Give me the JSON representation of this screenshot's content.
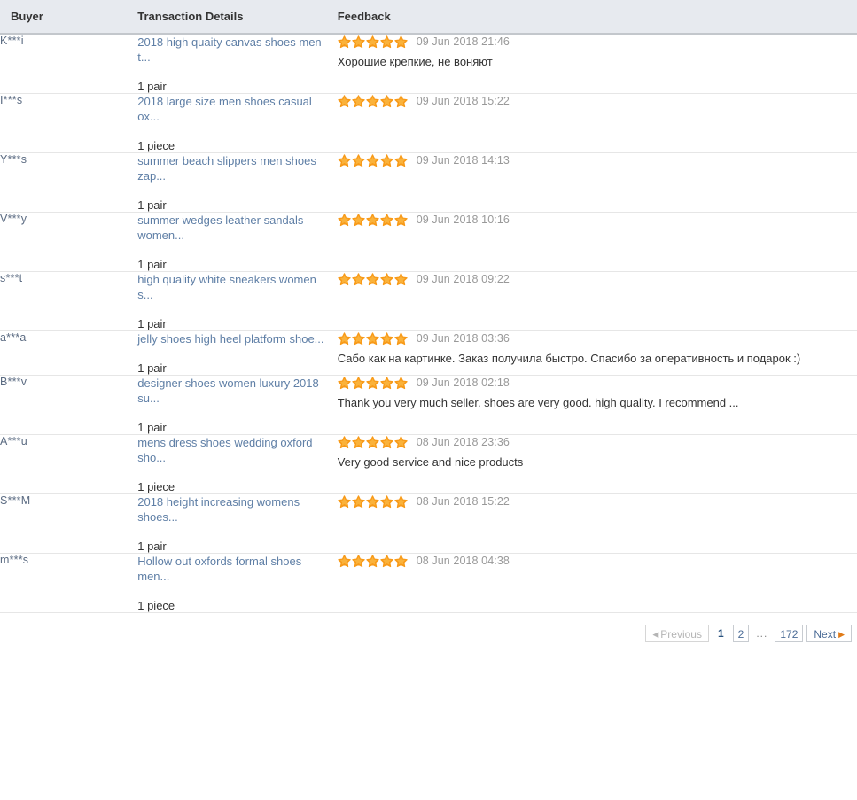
{
  "table": {
    "columns": [
      {
        "key": "buyer",
        "label": "Buyer"
      },
      {
        "key": "details",
        "label": "Transaction Details"
      },
      {
        "key": "feedback",
        "label": "Feedback"
      }
    ],
    "rows": [
      {
        "buyer": "K***i",
        "item": "2018 high quaity canvas shoes men t...",
        "quantity": "1 pair",
        "rating": 5,
        "date": "09 Jun 2018 21:46",
        "comment": "Хорошие крепкие, не воняют"
      },
      {
        "buyer": "I***s",
        "item": "2018 large size men shoes casual ox...",
        "quantity": "1 piece",
        "rating": 5,
        "date": "09 Jun 2018 15:22",
        "comment": ""
      },
      {
        "buyer": "Y***s",
        "item": "summer beach slippers men shoes zap...",
        "quantity": "1 pair",
        "rating": 5,
        "date": "09 Jun 2018 14:13",
        "comment": ""
      },
      {
        "buyer": "V***y",
        "item": "summer wedges leather sandals women...",
        "quantity": "1 pair",
        "rating": 5,
        "date": "09 Jun 2018 10:16",
        "comment": ""
      },
      {
        "buyer": "s***t",
        "item": "high quality white sneakers women s...",
        "quantity": "1 pair",
        "rating": 5,
        "date": "09 Jun 2018 09:22",
        "comment": ""
      },
      {
        "buyer": "a***a",
        "item": "jelly shoes high heel platform shoe...",
        "quantity": "1 pair",
        "rating": 5,
        "date": "09 Jun 2018 03:36",
        "comment": "Сабо как на картинке. Заказ получила быстро. Спасибо за оперативность и подарок :)"
      },
      {
        "buyer": "B***v",
        "item": "designer shoes women luxury 2018 su...",
        "quantity": "1 pair",
        "rating": 5,
        "date": "09 Jun 2018 02:18",
        "comment": "Thank you very much seller. shoes are very good. high quality. I recommend ..."
      },
      {
        "buyer": "A***u",
        "item": "mens dress shoes wedding oxford sho...",
        "quantity": "1 piece",
        "rating": 5,
        "date": "08 Jun 2018 23:36",
        "comment": "Very good service and nice products"
      },
      {
        "buyer": "S***M",
        "item": "2018 height increasing womens shoes...",
        "quantity": "1 pair",
        "rating": 5,
        "date": "08 Jun 2018 15:22",
        "comment": ""
      },
      {
        "buyer": "m***s",
        "item": "Hollow out oxfords formal shoes men...",
        "quantity": "1 piece",
        "rating": 5,
        "date": "08 Jun 2018 04:38",
        "comment": ""
      }
    ]
  },
  "pagination": {
    "previous_label": "Previous",
    "next_label": "Next",
    "ellipsis": "...",
    "pages": [
      "1",
      "2"
    ],
    "last_page": "172",
    "current_page": "1",
    "prev_arrow_icon": "triangle-left-icon",
    "next_arrow_icon": "triangle-right-icon"
  },
  "style": {
    "star_color": "#f89a18",
    "star_icon": "star-filled-icon",
    "link_color": "#5f7fa6",
    "header_bg": "#e7eaef",
    "date_color": "#999999"
  }
}
